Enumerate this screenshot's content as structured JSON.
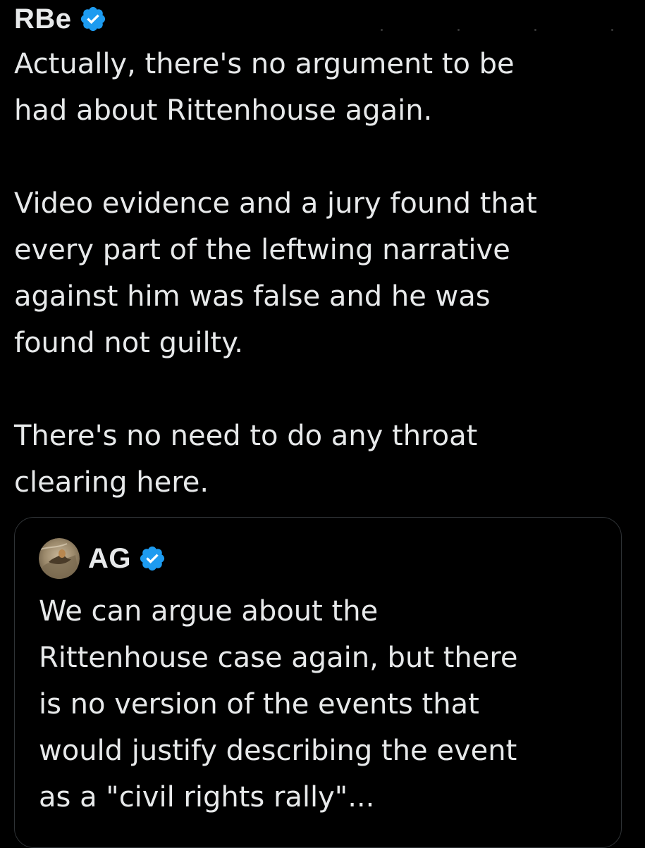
{
  "tweet": {
    "author": {
      "name": "RBe",
      "verified_icon": "verified-badge-icon"
    },
    "text": "Actually, there's no argument to be\nhad about Rittenhouse again.\n\nVideo evidence and a jury found that\nevery part of the leftwing narrative\nagainst him was false and he was\nfound not guilty.\n\nThere's no need to do any throat\nclearing here."
  },
  "quoted_tweet": {
    "author": {
      "name": "AG",
      "avatar_icon": "avatar-image",
      "verified_icon": "verified-badge-icon"
    },
    "text": "We can argue about the\nRittenhouse case again, but there\nis no version of the events that\nwould justify describing the event\nas a \"civil rights rally\"..."
  },
  "colors": {
    "background": "#000000",
    "text": "#e7e9ea",
    "verified_blue": "#1d9bf0",
    "border": "#2f3336"
  }
}
